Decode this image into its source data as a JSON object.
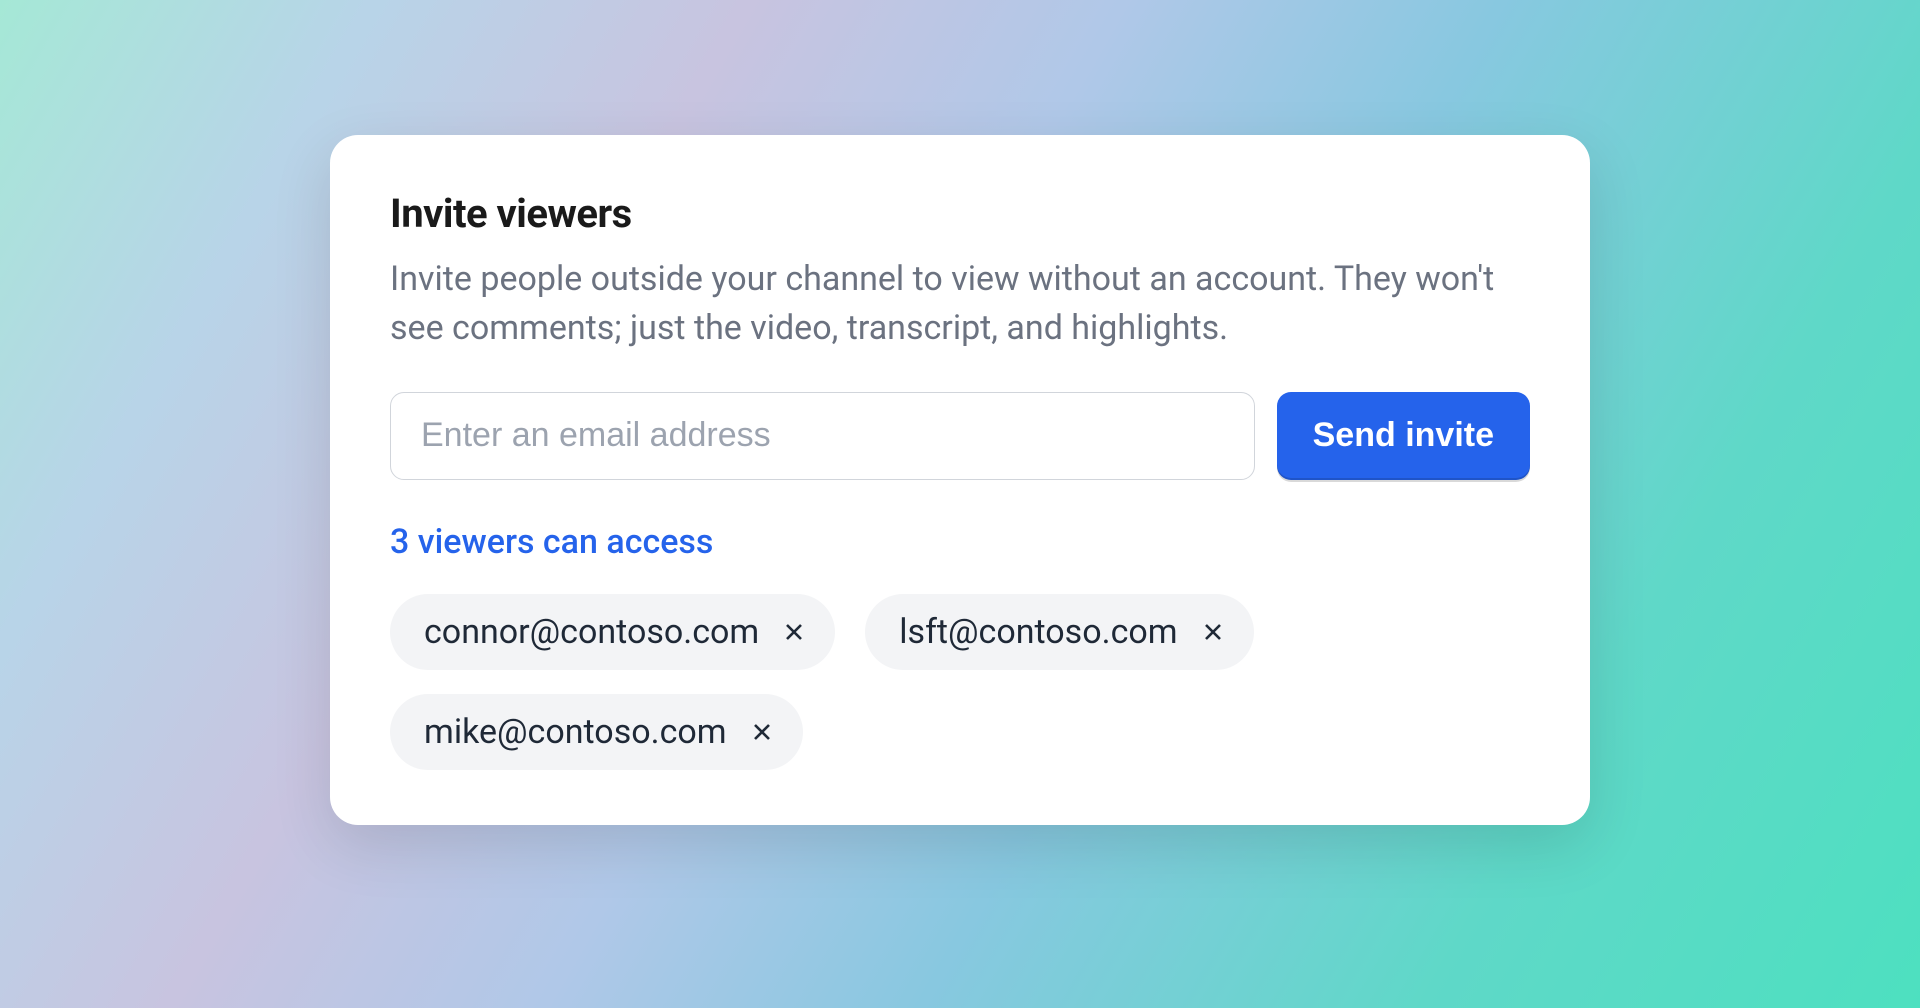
{
  "card": {
    "title": "Invite viewers",
    "description": "Invite people outside your channel to view without an account. They won't see comments; just the video, transcript, and highlights.",
    "email_placeholder": "Enter an email address",
    "send_button_label": "Send invite",
    "access_link_label": "3 viewers can access",
    "viewers": [
      {
        "email": "connor@contoso.com"
      },
      {
        "email": "lsft@contoso.com"
      },
      {
        "email": "mike@contoso.com"
      }
    ]
  },
  "colors": {
    "primary": "#2563eb",
    "text_primary": "#1a1a1a",
    "text_secondary": "#6b7280",
    "chip_bg": "#f3f4f6",
    "border": "#d1d5db"
  }
}
